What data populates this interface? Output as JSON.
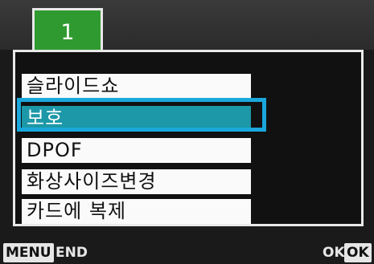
{
  "tab": {
    "label": "1"
  },
  "menu": {
    "items": [
      {
        "label": "슬라이드쇼"
      },
      {
        "label": "보호"
      },
      {
        "label": "DPOF"
      },
      {
        "label": "화상사이즈변경"
      },
      {
        "label": "카드에 복제"
      }
    ],
    "selected_index": 1
  },
  "footer": {
    "menu_key": "MENU",
    "menu_action": "END",
    "ok_action": "OK",
    "ok_key": "OK"
  },
  "colors": {
    "tab": "#2f9a2f",
    "selection": "#1d98a8",
    "selection_frame": "#1aa8dc"
  }
}
